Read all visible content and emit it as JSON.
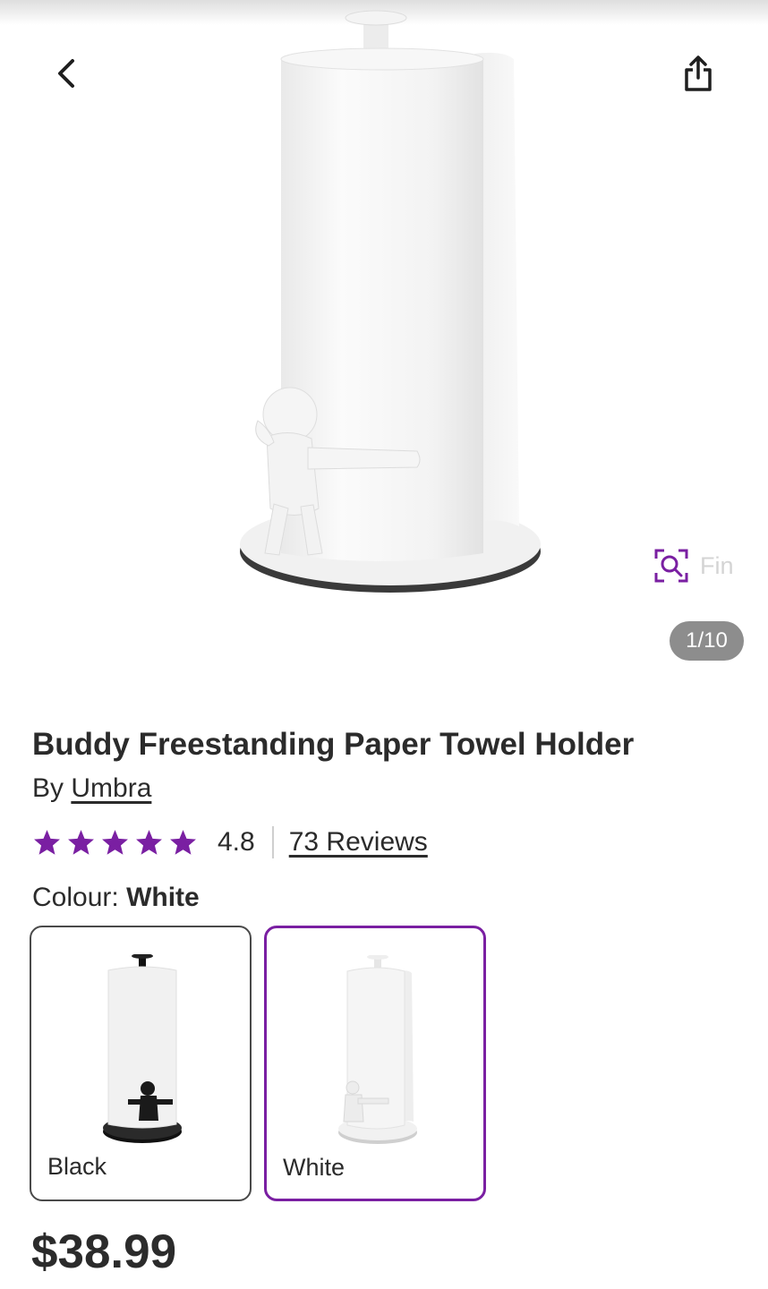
{
  "gallery": {
    "counter": "1/10",
    "find_similar_label": "Fin"
  },
  "product": {
    "title": "Buddy Freestanding Paper Towel Holder",
    "by_prefix": "By ",
    "brand": "Umbra",
    "rating_value": "4.8",
    "stars": 5,
    "reviews_label": "73 Reviews",
    "colour_label": "Colour:",
    "selected_colour": "White",
    "price": "$38.99"
  },
  "swatches": [
    {
      "label": "Black",
      "selected": false
    },
    {
      "label": "White",
      "selected": true
    }
  ],
  "icons": {
    "back": "chevron-left-icon",
    "share": "share-icon",
    "visual_search": "visual-search-icon",
    "star": "star-icon"
  },
  "colors": {
    "accent": "#7a1fa2",
    "star": "#7a1fa2",
    "counter_bg": "#8d8d8d",
    "text": "#2b2b2b"
  }
}
